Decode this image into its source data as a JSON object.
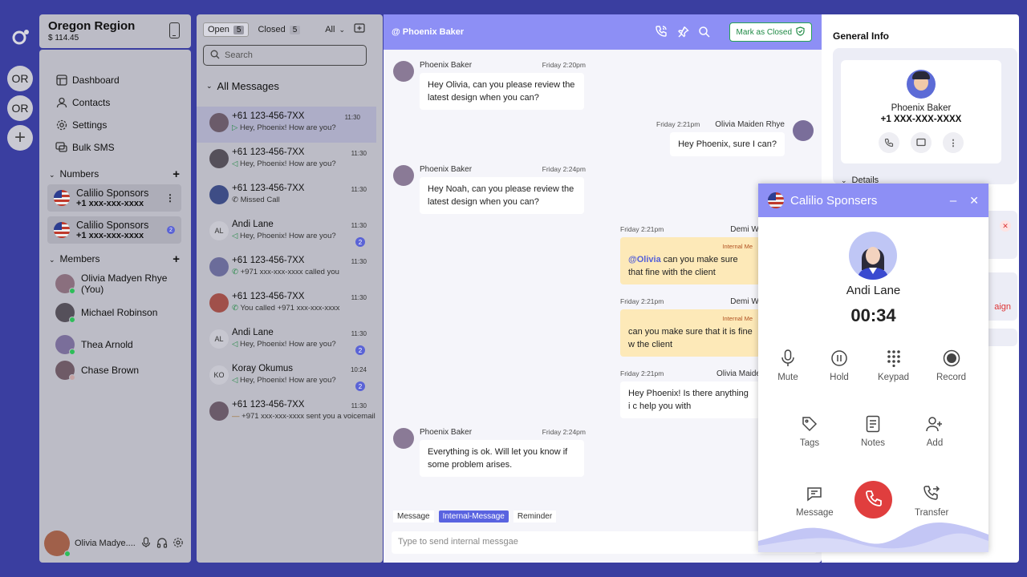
{
  "workspaces": [
    "OR",
    "OR"
  ],
  "region": {
    "title": "Oregon Region",
    "balance": "$ 114.45"
  },
  "nav": [
    {
      "label": "Dashboard",
      "icon": "dashboard-icon"
    },
    {
      "label": "Contacts",
      "icon": "user-icon"
    },
    {
      "label": "Settings",
      "icon": "gear-icon"
    },
    {
      "label": "Bulk SMS",
      "icon": "chat-icon"
    }
  ],
  "numbers_label": "Numbers",
  "numbers": [
    {
      "name": "Calilio Sponsors",
      "number": "+1 xxx-xxx-xxxx"
    },
    {
      "name": "Calilio Sponsors",
      "number": "+1 xxx-xxx-xxxx",
      "count": "2"
    }
  ],
  "members_label": "Members",
  "members": [
    "Olivia Madyen Rhye (You)",
    "Michael Robinson",
    "Thea Arnold",
    "Chase Brown"
  ],
  "footer": {
    "name": "Olivia Madye...."
  },
  "list": {
    "open_label": "Open",
    "open_count": "5",
    "closed_label": "Closed",
    "closed_count": "5",
    "filter": "All",
    "search_placeholder": "Search",
    "section": "All Messages",
    "items": [
      {
        "name": "+61 123-456-7XX",
        "msg": "Hey, Phoenix! How are you?",
        "time": "11:30"
      },
      {
        "name": "+61 123-456-7XX",
        "msg": "Hey, Phoenix! How are you?",
        "time": "11:30"
      },
      {
        "name": "+61 123-456-7XX",
        "msg": "Missed Call",
        "time": "11:30"
      },
      {
        "name": "Andi Lane",
        "initials": "AL",
        "msg": "Hey, Phoenix! How are you?",
        "time": "11:30",
        "count": "2"
      },
      {
        "name": "+61 123-456-7XX",
        "msg": "+971 xxx-xxx-xxxx called you",
        "time": "11:30"
      },
      {
        "name": "+61 123-456-7XX",
        "msg": "You called +971 xxx-xxx-xxxx",
        "time": "11:30"
      },
      {
        "name": "Andi Lane",
        "initials": "AL",
        "msg": "Hey, Phoenix! How are you?",
        "time": "11:30",
        "count": "2"
      },
      {
        "name": "Koray Okumus",
        "initials": "KO",
        "msg": "Hey, Phoenix! How are you?",
        "time": "10:24",
        "count": "2"
      },
      {
        "name": "+61 123-456-7XX",
        "msg": "+971 xxx-xxx-xxxx sent you a voicemail",
        "time": "11:30"
      }
    ]
  },
  "chat": {
    "title": "@ Phoenix Baker",
    "close_label": "Mark as Closed",
    "messages": [
      {
        "who": "Phoenix Baker",
        "when": "Friday 2:20pm",
        "text": "Hey Olivia, can you please review the latest design when you can?"
      },
      {
        "who": "Olivia Maiden Rhye",
        "when": "Friday 2:21pm",
        "text": "Hey Phoenix, sure I can?"
      },
      {
        "who": "Phoenix Baker",
        "when": "Friday 2:24pm",
        "text": "Hey Noah, can you please review the latest design when you can?"
      },
      {
        "who": "Demi Wi",
        "when": "Friday 2:21pm",
        "tag": "Internal Me",
        "mention": "@Olivia",
        "text": " can you make sure that fine with the client"
      },
      {
        "who": "Demi Wi",
        "when": "Friday 2:21pm",
        "tag": "Internal Me",
        "text": "can you make sure that it is fine w the client"
      },
      {
        "who": "Olivia Maide",
        "when": "Friday 2:21pm",
        "text": "Hey Phoenix! Is there anything i c help you with"
      },
      {
        "who": "Phoenix Baker",
        "when": "Friday 2:24pm",
        "text": "Everything is ok. Will let you know if some problem arises."
      }
    ],
    "tabs": [
      "Message",
      "Internal-Message",
      "Reminder"
    ],
    "input_placeholder": "Type to send internal messgae"
  },
  "info": {
    "title": "General Info",
    "name": "Phoenix Baker",
    "number": "+1 XXX-XXX-XXXX",
    "details": "Details",
    "partial": "aign"
  },
  "call": {
    "line": "Calilio Sponsers",
    "name": "Andi Lane",
    "timer": "00:34",
    "controls": [
      "Mute",
      "Hold",
      "Keypad",
      "Record"
    ],
    "actions": [
      "Tags",
      "Notes",
      "Add"
    ],
    "bottom": [
      "Message",
      "Transfer"
    ],
    "end_color": "#e03e3e"
  }
}
